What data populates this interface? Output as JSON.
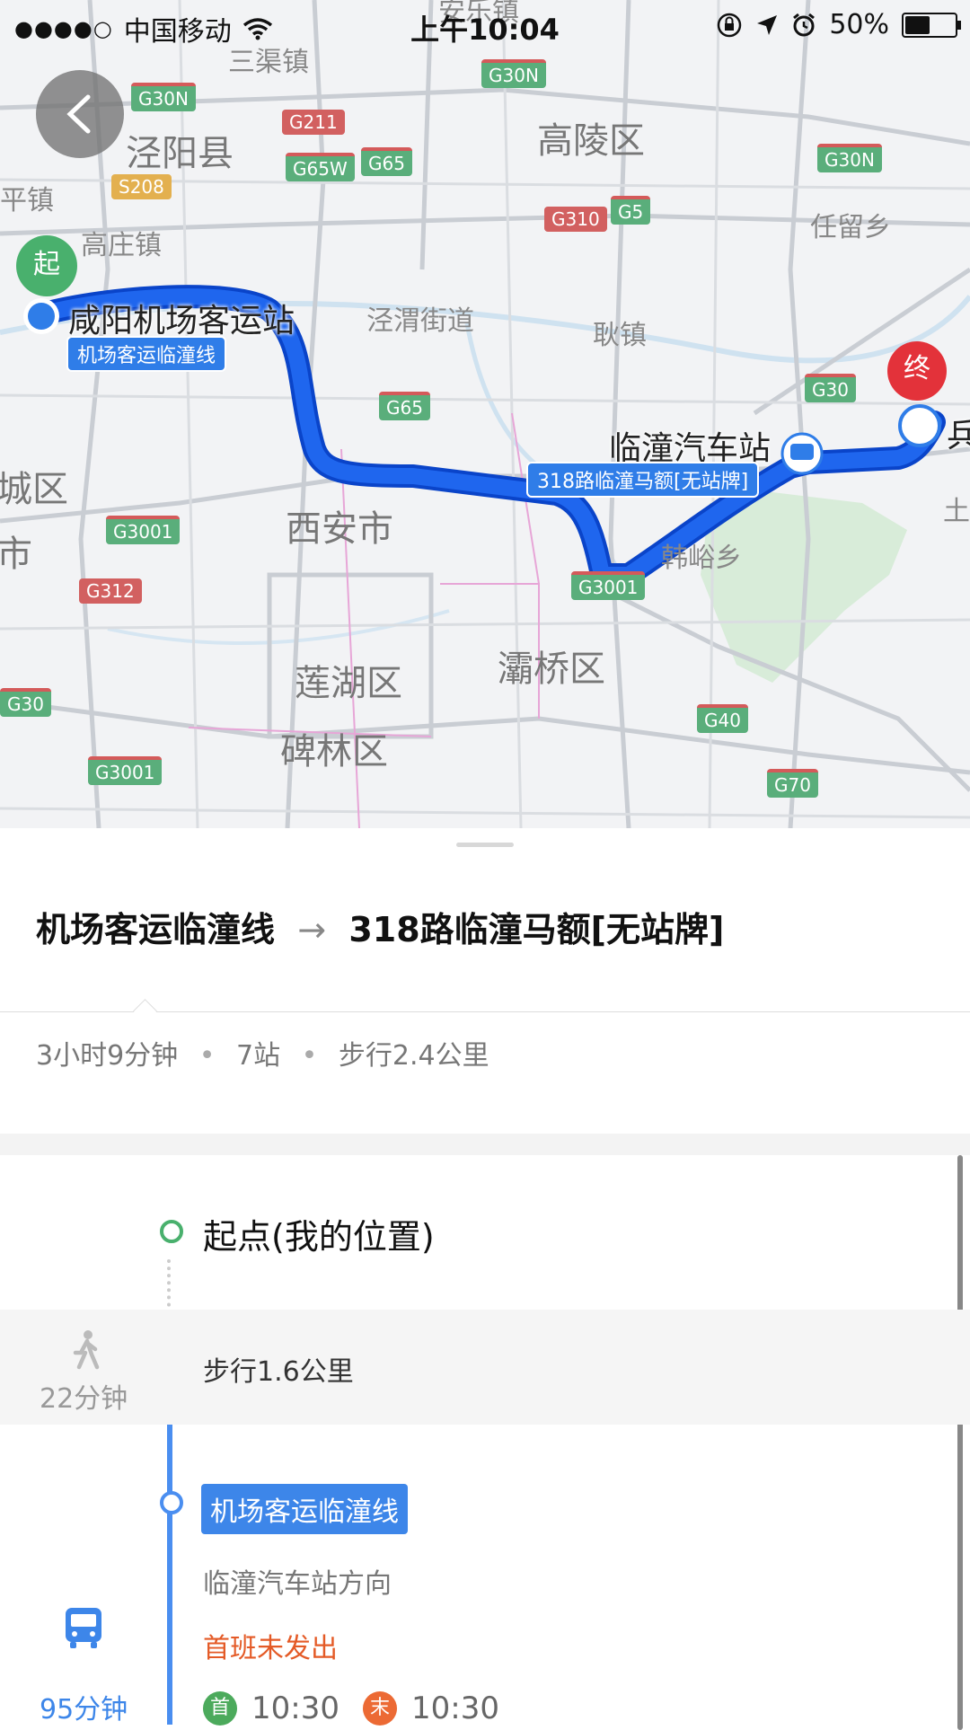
{
  "status_bar": {
    "signal": "●●●●○",
    "carrier": "中国移动",
    "time": "上午10:04",
    "battery_percent": "50%"
  },
  "map": {
    "labels": {
      "sanqu": "三渠镇",
      "anle": "安乐镇",
      "jingyang": "泾阳县",
      "gaoling": "高陵区",
      "gaozhuang": "高庄镇",
      "renliu": "任留乡",
      "pingzhen": "平镇",
      "jingwei": "泾渭街道",
      "gengzhen": "耿镇",
      "xian": "西安市",
      "hanyu": "韩峪乡",
      "chengqu": "城区",
      "shi": "市",
      "lianhu": "莲湖区",
      "baqiao": "灞桥区",
      "beilin": "碑林区",
      "tu": "土"
    },
    "shields": {
      "g30n_a": "G30N",
      "g30n_b": "G30N",
      "g30n_c": "G30N",
      "g211": "G211",
      "g65w": "G65W",
      "g65_a": "G65",
      "g65_b": "G65",
      "s208": "S208",
      "g310": "G310",
      "g5": "G5",
      "g30_a": "G30",
      "g3001_a": "G3001",
      "g3001_b": "G3001",
      "g3001_c": "G3001",
      "g312": "G312",
      "g30_b": "G30",
      "g40": "G40",
      "g70": "G70"
    },
    "start_pin": "起",
    "end_pin": "终",
    "start_station": "咸阳机场客运站",
    "start_line_tag": "机场客运临潼线",
    "mid_station": "临潼汽车站",
    "mid_line_tag": "318路临潼马额[无站牌]",
    "end_station_partial": "兵"
  },
  "route": {
    "title_from": "机场客运临潼线",
    "arrow": "→",
    "title_to": "318路临潼马额[无站牌]",
    "duration": "3小时9分钟",
    "stops": "7站",
    "walk_total": "步行2.4公里",
    "separator": "•"
  },
  "steps": {
    "start_label": "起点(我的位置)",
    "walk_time": "22分钟",
    "walk_text": "步行1.6公里",
    "bus_line": "机场客运临潼线",
    "bus_direction": "临潼汽车站方向",
    "first_status": "首班未发出",
    "bus_time": "95分钟",
    "first_badge": "首",
    "first_time": "10:30",
    "last_badge": "末",
    "last_time": "10:30"
  }
}
